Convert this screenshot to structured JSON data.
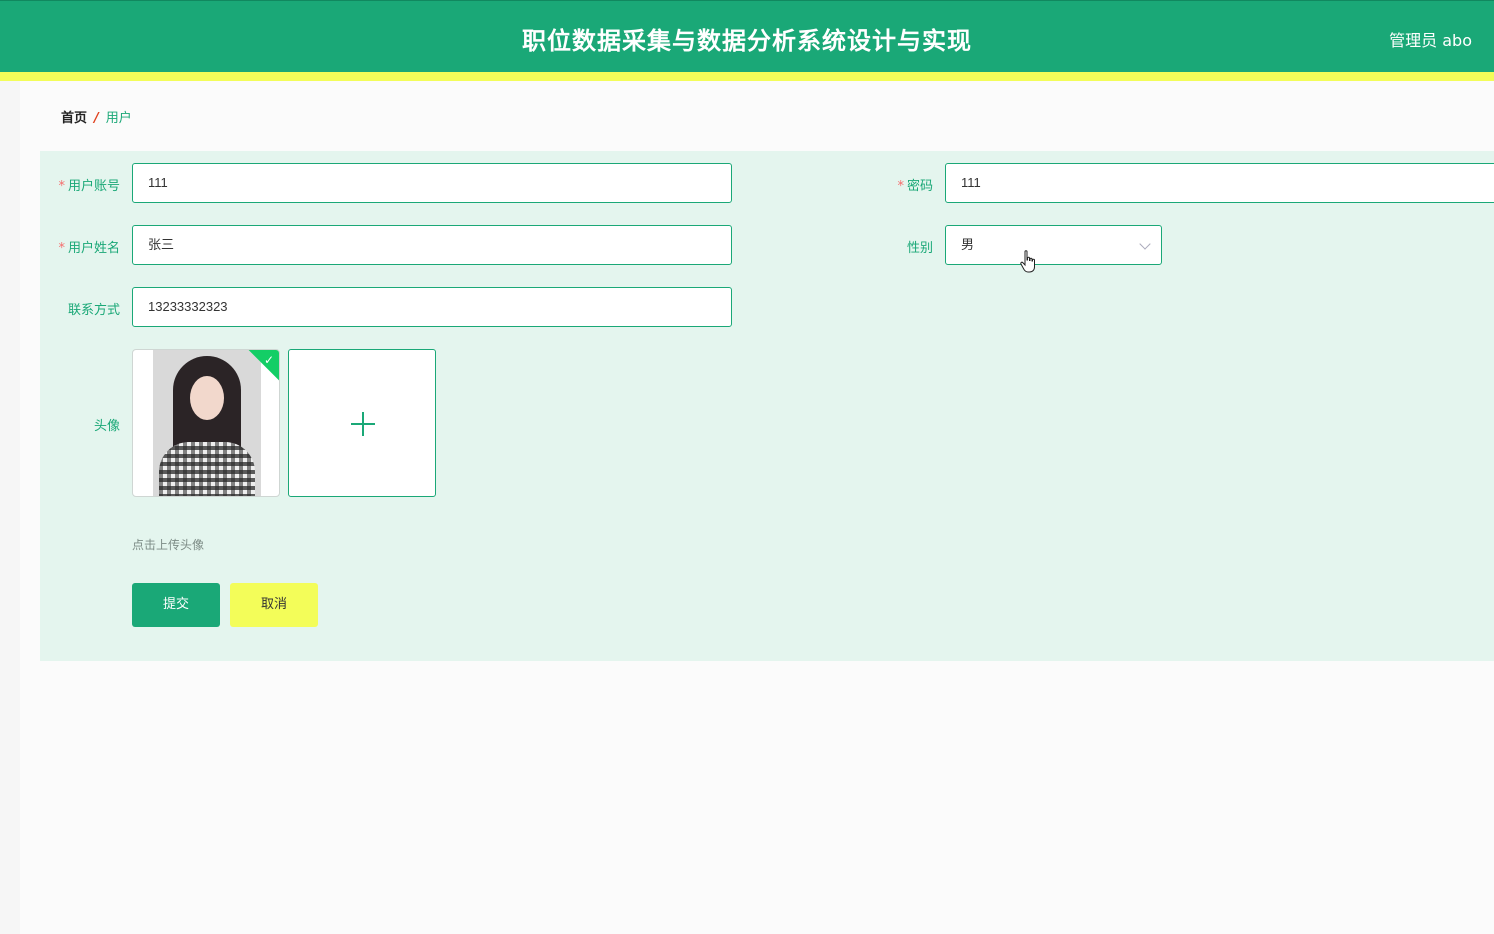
{
  "header": {
    "title": "职位数据采集与数据分析系统设计与实现",
    "user": "管理员 abo"
  },
  "colors": {
    "primary": "#1aa877",
    "accent_yellow": "#f3fd59",
    "panel_bg": "#e4f5ee",
    "required": "#f56c6c"
  },
  "breadcrumb": {
    "home": "首页",
    "separator": "/",
    "current": "用户"
  },
  "form": {
    "account": {
      "required_mark": "*",
      "label": "用户账号",
      "value": "111"
    },
    "password": {
      "required_mark": "*",
      "label": "密码",
      "value": "111"
    },
    "name": {
      "required_mark": "*",
      "label": "用户姓名",
      "value": "张三"
    },
    "gender": {
      "label": "性别",
      "value": "男"
    },
    "phone": {
      "label": "联系方式",
      "value": "13233332323"
    },
    "avatar": {
      "label": "头像",
      "tip": "点击上传头像",
      "check_icon": "✓"
    }
  },
  "buttons": {
    "submit": "提交",
    "cancel": "取消"
  }
}
